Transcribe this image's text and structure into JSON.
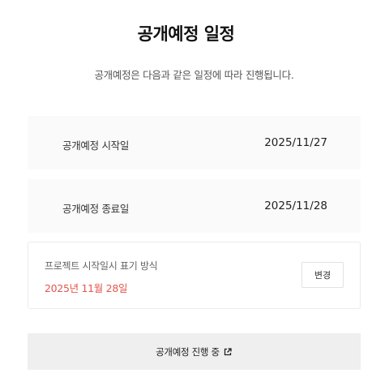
{
  "header": {
    "title": "공개예정 일정",
    "subtitle": "공개예정은 다음과 같은 일정에 따라 진행됩니다."
  },
  "schedule": {
    "start": {
      "label": "공개예정 시작일",
      "value": "2025/11/27"
    },
    "end": {
      "label": "공개예정 종료일",
      "value": "2025/11/28"
    }
  },
  "display_format": {
    "label": "프로젝트 시작일시 표기 방식",
    "value": "2025년 11월 28일",
    "change_button": "변경"
  },
  "status": {
    "label": "공개예정 진행 중",
    "icon": "external-link-icon"
  },
  "colors": {
    "accent": "#e2574c",
    "row_background": "#fafafa",
    "status_background": "#efefef"
  }
}
